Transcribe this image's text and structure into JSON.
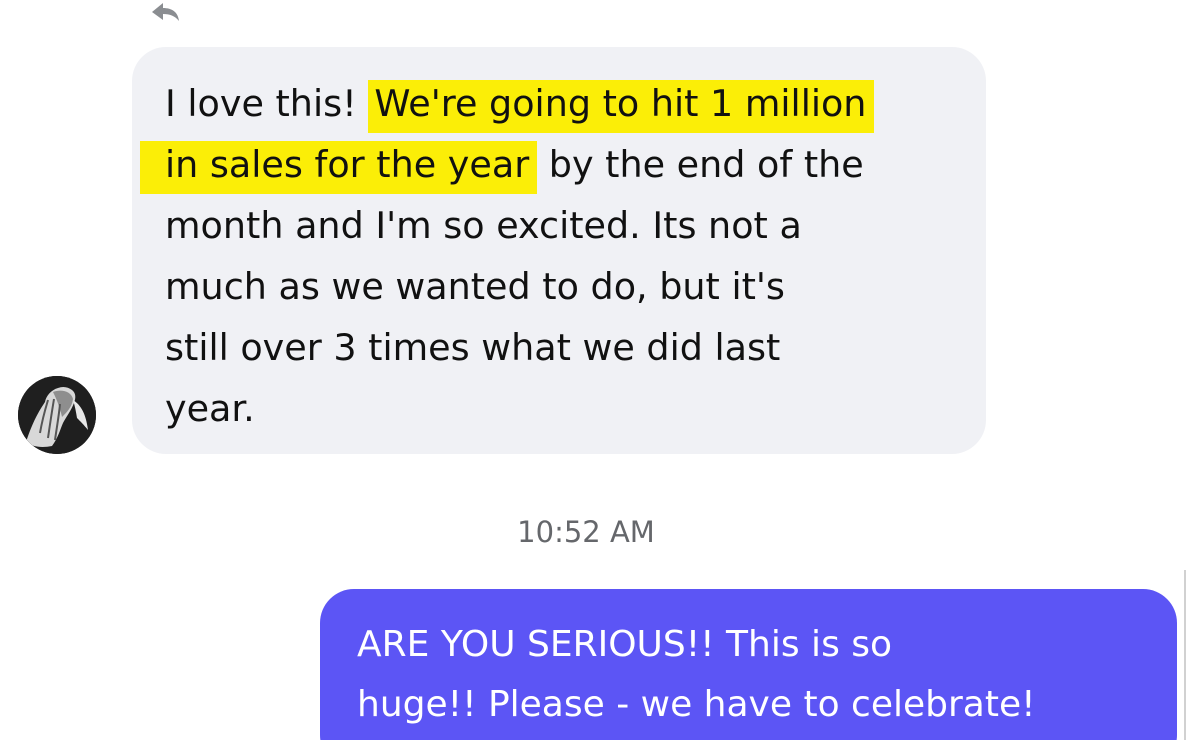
{
  "incoming": {
    "icon": "reply-icon",
    "avatar": "avatar",
    "lines": [
      {
        "before": "I love this! ",
        "highlight": "We're going to hit 1 million",
        "after": ""
      },
      {
        "before": "",
        "highlight": "in sales for the year",
        "after": " by the end of the"
      },
      {
        "before": "month and I'm so excited.  Its not a",
        "highlight": "",
        "after": ""
      },
      {
        "before": "much as we wanted to do, but it's",
        "highlight": "",
        "after": ""
      },
      {
        "before": "still over 3 times what we did last",
        "highlight": "",
        "after": ""
      },
      {
        "before": "year.",
        "highlight": "",
        "after": ""
      }
    ]
  },
  "timestamp": "10:52 AM",
  "outgoing": {
    "lines": [
      "ARE YOU SERIOUS!! This is so",
      "huge!! Please - we have to celebrate!"
    ]
  },
  "colors": {
    "incoming_bubble": "#f0f1f5",
    "outgoing_bubble": "#5c55f5",
    "highlight": "#fbee07",
    "timestamp": "#65676b"
  }
}
